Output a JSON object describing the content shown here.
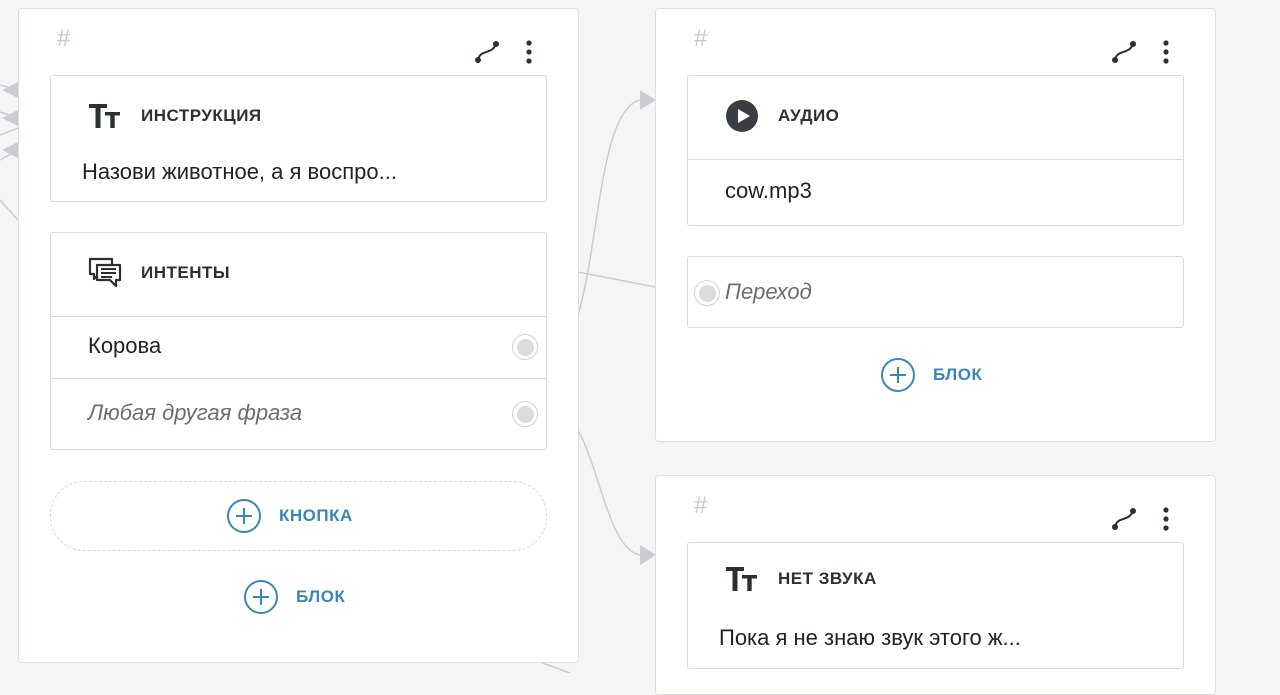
{
  "colors": {
    "accent": "#3b86b8",
    "border": "#d7dade",
    "edge": "#c9ccd0",
    "background": "#f4f5f7"
  },
  "card1": {
    "hash": "#",
    "instruction": {
      "title": "ИНСТРУКЦИЯ",
      "text": "Назови животное, а я воспро...",
      "icon": "text-format-icon"
    },
    "intents": {
      "title": "ИНТЕНТЫ",
      "icon": "chat-lines-icon",
      "items": [
        "Корова",
        "Любая другая фраза"
      ]
    },
    "button_label": "КНОПКА",
    "block_label": "БЛОК"
  },
  "card2": {
    "hash": "#",
    "audio": {
      "title": "АУДИО",
      "file": "cow.mp3",
      "icon": "play-circle-icon"
    },
    "transition_placeholder": "Переход",
    "block_label": "БЛОК"
  },
  "card3": {
    "hash": "#",
    "section": {
      "title": "НЕТ ЗВУКА",
      "text": "Пока я не знаю звук этого ж...",
      "icon": "text-format-icon"
    }
  }
}
